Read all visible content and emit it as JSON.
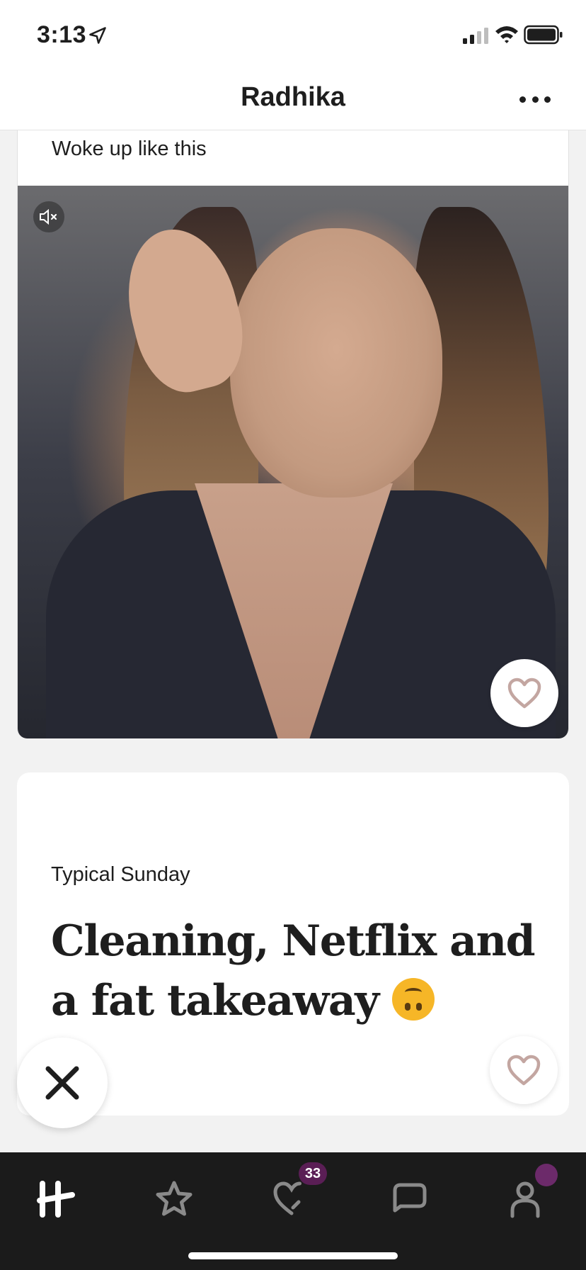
{
  "status_bar": {
    "time": "3:13",
    "icons": [
      "location-arrow-icon",
      "signal-icon",
      "wifi-icon",
      "battery-icon"
    ]
  },
  "header": {
    "title": "Radhika",
    "more_icon": "more-dots-icon"
  },
  "photo_card": {
    "caption": "Woke up like this",
    "mute_icon": "muted-speaker-icon",
    "like_icon": "heart-outline-icon"
  },
  "prompt_card": {
    "question": "Typical Sunday",
    "answer": "Cleaning, Netflix and a fat takeaway",
    "emoji": "upside-down-face-emoji",
    "like_icon": "heart-outline-icon"
  },
  "skip_button": {
    "icon": "close-x-icon"
  },
  "bottom_nav": {
    "items": [
      {
        "name": "home",
        "icon": "hinge-logo-icon",
        "active": true
      },
      {
        "name": "standouts",
        "icon": "star-icon",
        "active": false
      },
      {
        "name": "likes",
        "icon": "heart-check-icon",
        "active": false,
        "badge": "33"
      },
      {
        "name": "matches",
        "icon": "chat-bubble-icon",
        "active": false
      },
      {
        "name": "profile",
        "icon": "person-icon",
        "active": false,
        "dot": true
      }
    ]
  },
  "colors": {
    "accent_badge": "#5a1e55",
    "heart_icon": "#c3a6a1",
    "nav_background": "#1b1b1b",
    "page_background": "#f2f2f2"
  }
}
